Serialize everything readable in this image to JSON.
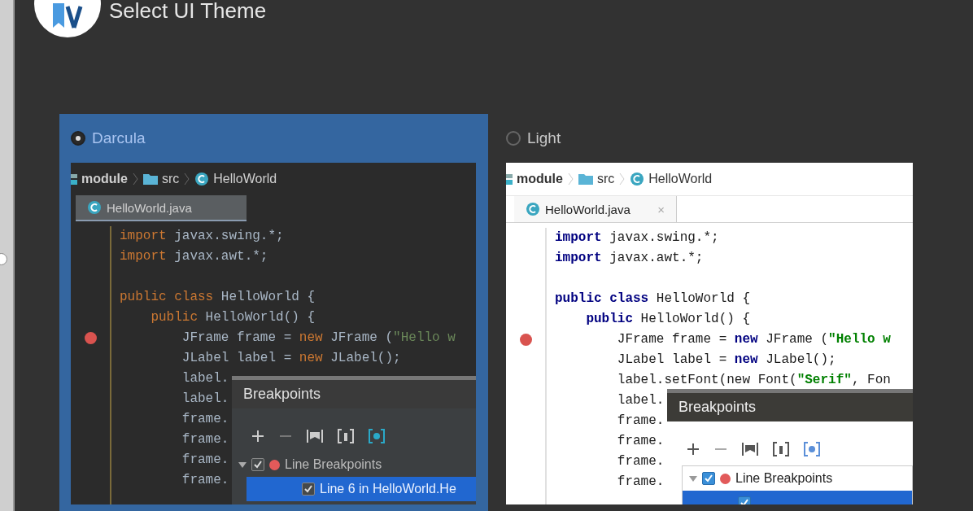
{
  "window": {
    "title": "Select UI Theme"
  },
  "themes": [
    {
      "name": "Darcula",
      "kind": "dark",
      "selected": true,
      "breadcrumb": [
        {
          "label": "module",
          "kind": "module"
        },
        {
          "label": "src",
          "kind": "folder"
        },
        {
          "label": "HelloWorld",
          "kind": "class"
        }
      ],
      "tab": {
        "label": "HelloWorld.java"
      },
      "code": [
        {
          "kind": "code",
          "breakpoint": false,
          "segments": [
            {
              "kind": "kw",
              "text": "import"
            },
            {
              "kind": "plain",
              "text": " javax.swing.*;"
            }
          ]
        },
        {
          "kind": "code",
          "breakpoint": false,
          "segments": [
            {
              "kind": "kw",
              "text": "import"
            },
            {
              "kind": "plain",
              "text": " javax.awt.*;"
            }
          ]
        },
        {
          "kind": "blank"
        },
        {
          "kind": "code",
          "breakpoint": false,
          "segments": [
            {
              "kind": "kw",
              "text": "public class"
            },
            {
              "kind": "plain",
              "text": " HelloWorld {"
            }
          ]
        },
        {
          "kind": "code",
          "breakpoint": false,
          "segments": [
            {
              "kind": "kw",
              "text": "    public"
            },
            {
              "kind": "plain",
              "text": " HelloWorld() {"
            }
          ]
        },
        {
          "kind": "code",
          "breakpoint": true,
          "segments": [
            {
              "kind": "plain",
              "text": "        JFrame frame = "
            },
            {
              "kind": "kw",
              "text": "new"
            },
            {
              "kind": "plain",
              "text": " JFrame ("
            },
            {
              "kind": "str",
              "text": "\"Hello w"
            }
          ]
        },
        {
          "kind": "code",
          "breakpoint": false,
          "segments": [
            {
              "kind": "plain",
              "text": "        JLabel label = "
            },
            {
              "kind": "kw",
              "text": "new"
            },
            {
              "kind": "plain",
              "text": " JLabel();"
            }
          ]
        },
        {
          "kind": "code",
          "breakpoint": false,
          "segments": [
            {
              "kind": "plain",
              "text": "        label."
            }
          ]
        },
        {
          "kind": "code",
          "breakpoint": false,
          "segments": [
            {
              "kind": "plain",
              "text": "        label."
            }
          ]
        },
        {
          "kind": "code",
          "breakpoint": false,
          "segments": [
            {
              "kind": "plain",
              "text": "        frame."
            }
          ]
        },
        {
          "kind": "code",
          "breakpoint": false,
          "segments": [
            {
              "kind": "plain",
              "text": "        frame."
            }
          ]
        },
        {
          "kind": "code",
          "breakpoint": false,
          "segments": [
            {
              "kind": "plain",
              "text": "        frame."
            }
          ]
        },
        {
          "kind": "code",
          "breakpoint": false,
          "segments": [
            {
              "kind": "plain",
              "text": "        frame."
            }
          ]
        }
      ],
      "popup": {
        "title": "Breakpoints",
        "rows": [
          {
            "label": "Line Breakpoints",
            "checked": true,
            "selected": false,
            "expanded": true,
            "children": [
              {
                "label": "Line 6 in HelloWorld.He",
                "checked": true,
                "selected": true
              }
            ]
          }
        ]
      }
    },
    {
      "name": "Light",
      "kind": "light",
      "selected": false,
      "breadcrumb": [
        {
          "label": "module",
          "kind": "module"
        },
        {
          "label": "src",
          "kind": "folder"
        },
        {
          "label": "HelloWorld",
          "kind": "class"
        }
      ],
      "tab": {
        "label": "HelloWorld.java",
        "close": "×"
      },
      "code": [
        {
          "kind": "code",
          "breakpoint": false,
          "segments": [
            {
              "kind": "kw",
              "text": "import"
            },
            {
              "kind": "plain",
              "text": " javax.swing.*;"
            }
          ]
        },
        {
          "kind": "code",
          "breakpoint": false,
          "segments": [
            {
              "kind": "kw",
              "text": "import"
            },
            {
              "kind": "plain",
              "text": " javax.awt.*;"
            }
          ]
        },
        {
          "kind": "blank"
        },
        {
          "kind": "code",
          "breakpoint": false,
          "segments": [
            {
              "kind": "kw",
              "text": "public class"
            },
            {
              "kind": "plain",
              "text": " HelloWorld {"
            }
          ]
        },
        {
          "kind": "code",
          "breakpoint": false,
          "segments": [
            {
              "kind": "kw",
              "text": "    public"
            },
            {
              "kind": "plain",
              "text": " HelloWorld() {"
            }
          ]
        },
        {
          "kind": "code",
          "breakpoint": true,
          "segments": [
            {
              "kind": "plain",
              "text": "        JFrame frame = "
            },
            {
              "kind": "kw",
              "text": "new"
            },
            {
              "kind": "plain",
              "text": " JFrame ("
            },
            {
              "kind": "str",
              "text": "\"Hello w"
            }
          ]
        },
        {
          "kind": "code",
          "breakpoint": false,
          "segments": [
            {
              "kind": "plain",
              "text": "        JLabel label = "
            },
            {
              "kind": "kw",
              "text": "new"
            },
            {
              "kind": "plain",
              "text": " JLabel();"
            }
          ]
        },
        {
          "kind": "code",
          "breakpoint": false,
          "segments": [
            {
              "kind": "plain",
              "text": "        label.setFont(new Font("
            },
            {
              "kind": "str",
              "text": "\"Serif\""
            },
            {
              "kind": "plain",
              "text": ", Fon"
            }
          ]
        },
        {
          "kind": "code",
          "breakpoint": false,
          "segments": [
            {
              "kind": "plain",
              "text": "        label."
            }
          ]
        },
        {
          "kind": "code",
          "breakpoint": false,
          "segments": [
            {
              "kind": "plain",
              "text": "        frame."
            }
          ]
        },
        {
          "kind": "code",
          "breakpoint": false,
          "segments": [
            {
              "kind": "plain",
              "text": "        frame."
            }
          ]
        },
        {
          "kind": "code",
          "breakpoint": false,
          "segments": [
            {
              "kind": "plain",
              "text": "        frame."
            }
          ]
        },
        {
          "kind": "code",
          "breakpoint": false,
          "segments": [
            {
              "kind": "plain",
              "text": "        frame."
            }
          ]
        }
      ],
      "popup": {
        "title": "Breakpoints",
        "rows": [
          {
            "label": "Line Breakpoints",
            "checked": true,
            "selected": false,
            "expanded": true,
            "children": [
              {
                "checked": true,
                "selected": true
              }
            ]
          }
        ]
      }
    }
  ]
}
